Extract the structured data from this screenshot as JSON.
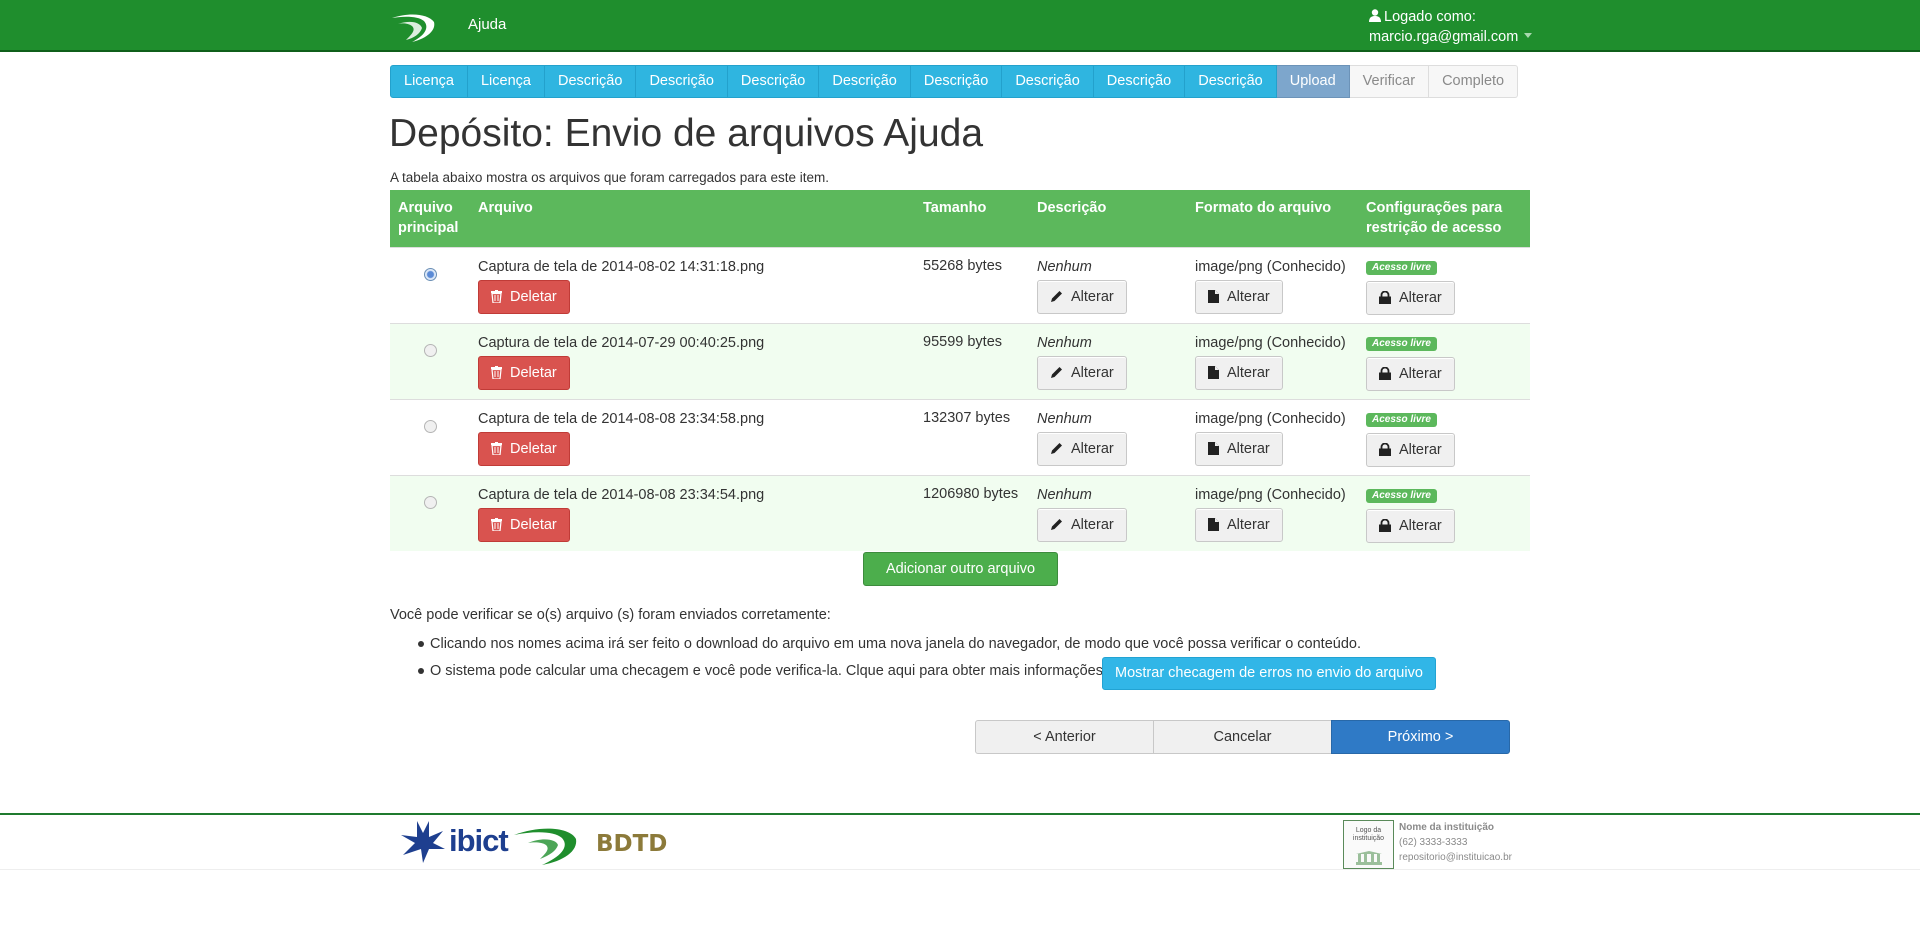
{
  "navbar": {
    "brand": "Ajuda",
    "user_line1": "Logado como:",
    "user_email": "marcio.rga@gmail.com"
  },
  "steps": [
    "Licença",
    "Licença",
    "Descrição",
    "Descrição",
    "Descrição",
    "Descrição",
    "Descrição",
    "Descrição",
    "Descrição",
    "Descrição",
    "Upload",
    "Verificar",
    "Completo"
  ],
  "page": {
    "title": "Depósito: Envio de arquivos Ajuda",
    "intro": "A tabela abaixo mostra os arquivos que foram carregados para este item."
  },
  "table": {
    "headers": {
      "primary": "Arquivo principal",
      "file": "Arquivo",
      "size": "Tamanho",
      "description": "Descrição",
      "format": "Formato do arquivo",
      "access": "Configurações para restrição de acesso"
    },
    "rows": [
      {
        "name": "Captura de tela de 2014-08-02 14:31:18.png",
        "size": "55268 bytes",
        "description": "Nenhum",
        "format": "image/png (Conhecido)",
        "access": "Acesso livre",
        "primary": true
      },
      {
        "name": "Captura de tela de 2014-07-29 00:40:25.png",
        "size": "95599 bytes",
        "description": "Nenhum",
        "format": "image/png (Conhecido)",
        "access": "Acesso livre",
        "primary": false
      },
      {
        "name": "Captura de tela de 2014-08-08 23:34:58.png",
        "size": "132307 bytes",
        "description": "Nenhum",
        "format": "image/png (Conhecido)",
        "access": "Acesso livre",
        "primary": false
      },
      {
        "name": "Captura de tela de 2014-08-08 23:34:54.png",
        "size": "1206980 bytes",
        "description": "Nenhum",
        "format": "image/png (Conhecido)",
        "access": "Acesso livre",
        "primary": false
      }
    ],
    "delete_label": "Deletar",
    "change_label": "Alterar"
  },
  "add_file_label": "Adicionar outro arquivo",
  "verify": {
    "text": "Você pode verificar se o(s) arquivo (s) foram enviados corretamente:",
    "bullet1": "Clicando nos nomes acima irá ser feito o download do arquivo em uma nova janela do navegador, de modo que você possa verificar o conteúdo.",
    "bullet2": "O sistema pode calcular uma checagem e você pode verifica-la. Clque aqui para obter mais informações.",
    "checksum_button": "Mostrar checagem de erros no envio do arquivo"
  },
  "nav_buttons": {
    "previous": "< Anterior",
    "cancel": "Cancelar",
    "next": "Próximo >"
  },
  "footer": {
    "ibict": "ibict",
    "bdtd": "BDTD",
    "inst_logo": "Logo da instituição",
    "inst_name": "Nome da instituição",
    "inst_phone": "(62) 3333-3333",
    "inst_email": "repositorio@instituicao.br"
  },
  "colors": {
    "navbar": "#1f8e2d",
    "table_header": "#5cb85c",
    "step_done": "#2fb5e0",
    "step_current": "#7da6cc",
    "danger": "#d9534f",
    "primary": "#2f7ac6"
  },
  "icons": {
    "delete": "trash-icon",
    "description": "pencil-icon",
    "format": "file-icon",
    "access": "lock-icon",
    "user": "user-icon"
  }
}
